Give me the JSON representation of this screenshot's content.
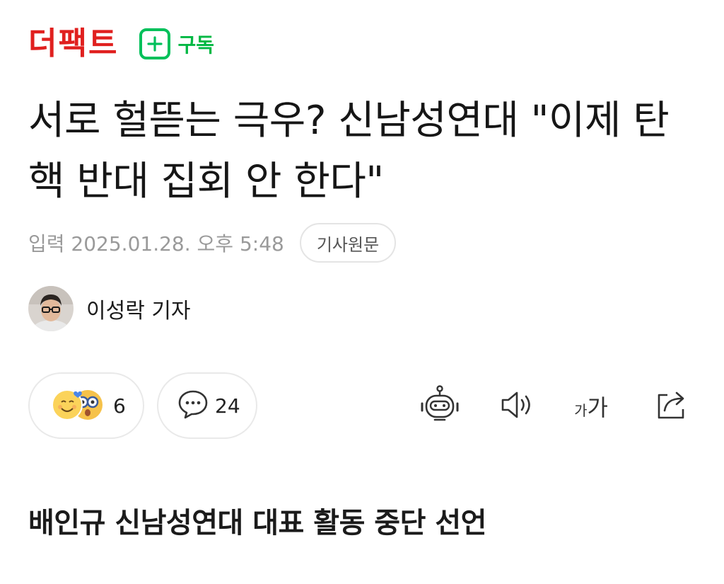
{
  "header": {
    "brand": "더팩트",
    "subscribe_label": "구독"
  },
  "article": {
    "headline": "서로 헐뜯는 극우? 신남성연대 \"이제 탄핵 반대 집회 안 한다\"",
    "date": "입력 2025.01.28. 오후 5:48",
    "original_button": "기사원문",
    "author": "이성락 기자",
    "subheading": "배인규 신남성연대 대표 활동 중단 선언"
  },
  "actions": {
    "reaction_count": "6",
    "comment_count": "24",
    "font_size_label_small": "가",
    "font_size_label_large": "가"
  },
  "colors": {
    "brand": "#e0201f",
    "subscribe": "#00b843",
    "muted": "#9a9a9a"
  },
  "icons": [
    "plus-icon",
    "reaction-emoji-icon",
    "comment-icon",
    "ai-summary-robot-icon",
    "speaker-icon",
    "font-size-icon",
    "share-icon"
  ]
}
